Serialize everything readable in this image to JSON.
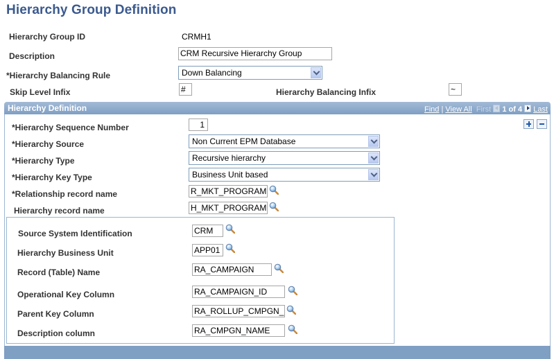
{
  "page": {
    "title": "Hierarchy Group Definition"
  },
  "header_fields": {
    "group_id": {
      "label": "Hierarchy Group ID",
      "value": "CRMH1"
    },
    "description": {
      "label": "Description",
      "value": "CRM Recursive Hierarchy Group"
    },
    "balancing_rule": {
      "label": "*Hierarchy Balancing Rule",
      "value": "Down Balancing"
    },
    "skip_level_infix": {
      "label": "Skip Level Infix",
      "value": "#"
    },
    "balancing_infix": {
      "label": "Hierarchy Balancing Infix",
      "value": "~"
    }
  },
  "panel": {
    "title": "Hierarchy Definition",
    "nav": {
      "find": "Find",
      "separator": "|",
      "view_all": "View All",
      "first": "First",
      "count": "1 of 4",
      "last": "Last"
    },
    "fields": {
      "sequence_number": {
        "label": "*Hierarchy Sequence Number",
        "value": "1"
      },
      "source": {
        "label": "*Hierarchy Source",
        "value": "Non Current EPM Database"
      },
      "type": {
        "label": "*Hierarchy Type",
        "value": "Recursive hierarchy"
      },
      "key_type": {
        "label": "*Hierarchy Key Type",
        "value": "Business Unit based"
      },
      "relationship_record": {
        "label": "*Relationship record name",
        "value": "R_MKT_PROGRAM"
      },
      "hierarchy_record": {
        "label": "Hierarchy record name",
        "value": "H_MKT_PROGRAM"
      }
    },
    "group": {
      "source_system": {
        "label": "Source System Identification",
        "value": "CRM"
      },
      "business_unit": {
        "label": "Hierarchy Business Unit",
        "value": "APP01"
      },
      "record_name": {
        "label": "Record (Table) Name",
        "value": "RA_CAMPAIGN"
      },
      "operational_key": {
        "label": "Operational Key Column",
        "value": "RA_CAMPAIGN_ID"
      },
      "parent_key": {
        "label": "Parent Key Column",
        "value": "RA_ROLLUP_CMPGN_I"
      },
      "description_column": {
        "label": "Description column",
        "value": "RA_CMPGN_NAME"
      }
    }
  },
  "icons": {
    "lookup": "magnifying-glass-icon",
    "dropdown": "chevron-down-icon",
    "add_row": "plus-icon",
    "delete_row": "minus-icon",
    "prev": "triangle-left-icon",
    "next": "triangle-right-icon"
  },
  "colors": {
    "title": "#3b5a8e",
    "panel_header": "#8ca8cb",
    "panel_border": "#9db6d3"
  }
}
